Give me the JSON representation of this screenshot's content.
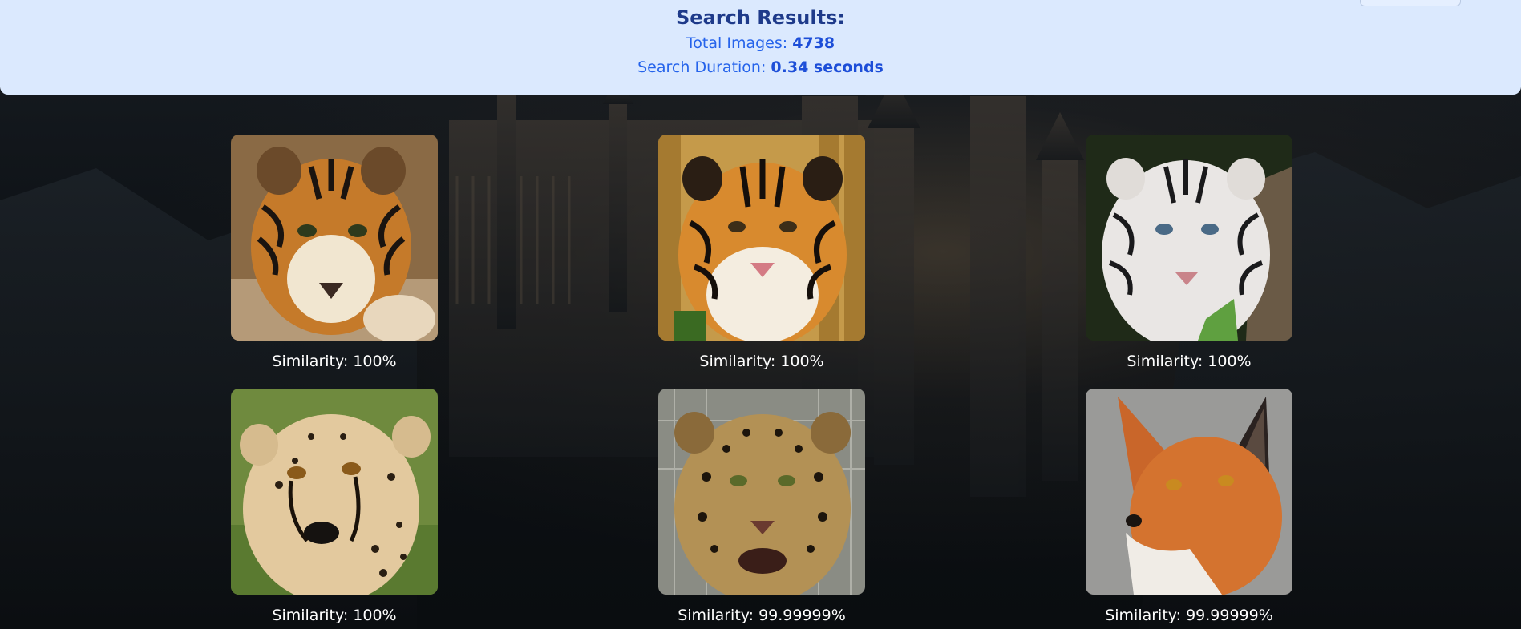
{
  "header": {
    "title": "Search Results:",
    "total_label": "Total Images:",
    "total_value": "4738",
    "duration_label": "Search Duration:",
    "duration_value": "0.34 seconds"
  },
  "results": [
    {
      "animal": "tiger",
      "similarity": "Similarity: 100%"
    },
    {
      "animal": "tiger",
      "similarity": "Similarity: 100%"
    },
    {
      "animal": "white-tiger",
      "similarity": "Similarity: 100%"
    },
    {
      "animal": "cheetah",
      "similarity": "Similarity: 100%"
    },
    {
      "animal": "leopard",
      "similarity": "Similarity: 99.99999%"
    },
    {
      "animal": "red-fox",
      "similarity": "Similarity: 99.99999%"
    }
  ],
  "colors": {
    "header_bg": "#dbe9fe",
    "title": "#1e3a8a",
    "accent": "#2563eb",
    "page_bg": "#0e1216"
  }
}
